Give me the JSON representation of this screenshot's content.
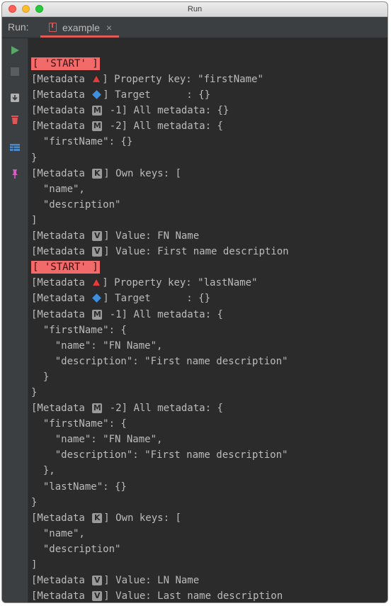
{
  "window": {
    "title": "Run"
  },
  "toolbar": {
    "run_label": "Run:",
    "tab_label": "example",
    "tab_close": "×"
  },
  "sidebar": {
    "icons": [
      "play-icon",
      "stop-icon",
      "scroll-to-end-icon",
      "trash-icon",
      "layout-icon",
      "pin-icon"
    ]
  },
  "console": {
    "lines": [
      [
        {
          "t": "start",
          "v": "[ 'START' ]"
        }
      ],
      [
        {
          "t": "text",
          "v": "[Metadata "
        },
        {
          "t": "tri"
        },
        {
          "t": "text",
          "v": "] Property key: \"firstName\""
        }
      ],
      [
        {
          "t": "text",
          "v": "[Metadata "
        },
        {
          "t": "dia"
        },
        {
          "t": "text",
          "v": "] Target      : {}"
        }
      ],
      [
        {
          "t": "text",
          "v": "[Metadata "
        },
        {
          "t": "letter",
          "v": "M"
        },
        {
          "t": "text",
          "v": " -1] All metadata: {}"
        }
      ],
      [
        {
          "t": "text",
          "v": "[Metadata "
        },
        {
          "t": "letter",
          "v": "M"
        },
        {
          "t": "text",
          "v": " -2] All metadata: {"
        }
      ],
      [
        {
          "t": "text",
          "v": "  \"firstName\": {}"
        }
      ],
      [
        {
          "t": "text",
          "v": "}"
        }
      ],
      [
        {
          "t": "text",
          "v": "[Metadata "
        },
        {
          "t": "letter",
          "v": "K"
        },
        {
          "t": "text",
          "v": "] Own keys: ["
        }
      ],
      [
        {
          "t": "text",
          "v": "  \"name\","
        }
      ],
      [
        {
          "t": "text",
          "v": "  \"description\""
        }
      ],
      [
        {
          "t": "text",
          "v": "]"
        }
      ],
      [
        {
          "t": "text",
          "v": "[Metadata "
        },
        {
          "t": "letter",
          "v": "V"
        },
        {
          "t": "text",
          "v": "] Value: FN Name"
        }
      ],
      [
        {
          "t": "text",
          "v": "[Metadata "
        },
        {
          "t": "letter",
          "v": "V"
        },
        {
          "t": "text",
          "v": "] Value: First name description"
        }
      ],
      [
        {
          "t": "start",
          "v": "[ 'START' ]"
        }
      ],
      [
        {
          "t": "text",
          "v": "[Metadata "
        },
        {
          "t": "tri"
        },
        {
          "t": "text",
          "v": "] Property key: \"lastName\""
        }
      ],
      [
        {
          "t": "text",
          "v": "[Metadata "
        },
        {
          "t": "dia"
        },
        {
          "t": "text",
          "v": "] Target      : {}"
        }
      ],
      [
        {
          "t": "text",
          "v": "[Metadata "
        },
        {
          "t": "letter",
          "v": "M"
        },
        {
          "t": "text",
          "v": " -1] All metadata: {"
        }
      ],
      [
        {
          "t": "text",
          "v": "  \"firstName\": {"
        }
      ],
      [
        {
          "t": "text",
          "v": "    \"name\": \"FN Name\","
        }
      ],
      [
        {
          "t": "text",
          "v": "    \"description\": \"First name description\""
        }
      ],
      [
        {
          "t": "text",
          "v": "  }"
        }
      ],
      [
        {
          "t": "text",
          "v": "}"
        }
      ],
      [
        {
          "t": "text",
          "v": "[Metadata "
        },
        {
          "t": "letter",
          "v": "M"
        },
        {
          "t": "text",
          "v": " -2] All metadata: {"
        }
      ],
      [
        {
          "t": "text",
          "v": "  \"firstName\": {"
        }
      ],
      [
        {
          "t": "text",
          "v": "    \"name\": \"FN Name\","
        }
      ],
      [
        {
          "t": "text",
          "v": "    \"description\": \"First name description\""
        }
      ],
      [
        {
          "t": "text",
          "v": "  },"
        }
      ],
      [
        {
          "t": "text",
          "v": "  \"lastName\": {}"
        }
      ],
      [
        {
          "t": "text",
          "v": "}"
        }
      ],
      [
        {
          "t": "text",
          "v": "[Metadata "
        },
        {
          "t": "letter",
          "v": "K"
        },
        {
          "t": "text",
          "v": "] Own keys: ["
        }
      ],
      [
        {
          "t": "text",
          "v": "  \"name\","
        }
      ],
      [
        {
          "t": "text",
          "v": "  \"description\""
        }
      ],
      [
        {
          "t": "text",
          "v": "]"
        }
      ],
      [
        {
          "t": "text",
          "v": "[Metadata "
        },
        {
          "t": "letter",
          "v": "V"
        },
        {
          "t": "text",
          "v": "] Value: LN Name"
        }
      ],
      [
        {
          "t": "text",
          "v": "[Metadata "
        },
        {
          "t": "letter",
          "v": "V"
        },
        {
          "t": "text",
          "v": "] Value: Last name description"
        }
      ]
    ]
  },
  "colors": {
    "start_bg": "#f26a6a",
    "tab_underline": "#e05a5a",
    "play": "#59a869",
    "trash": "#e05555"
  }
}
